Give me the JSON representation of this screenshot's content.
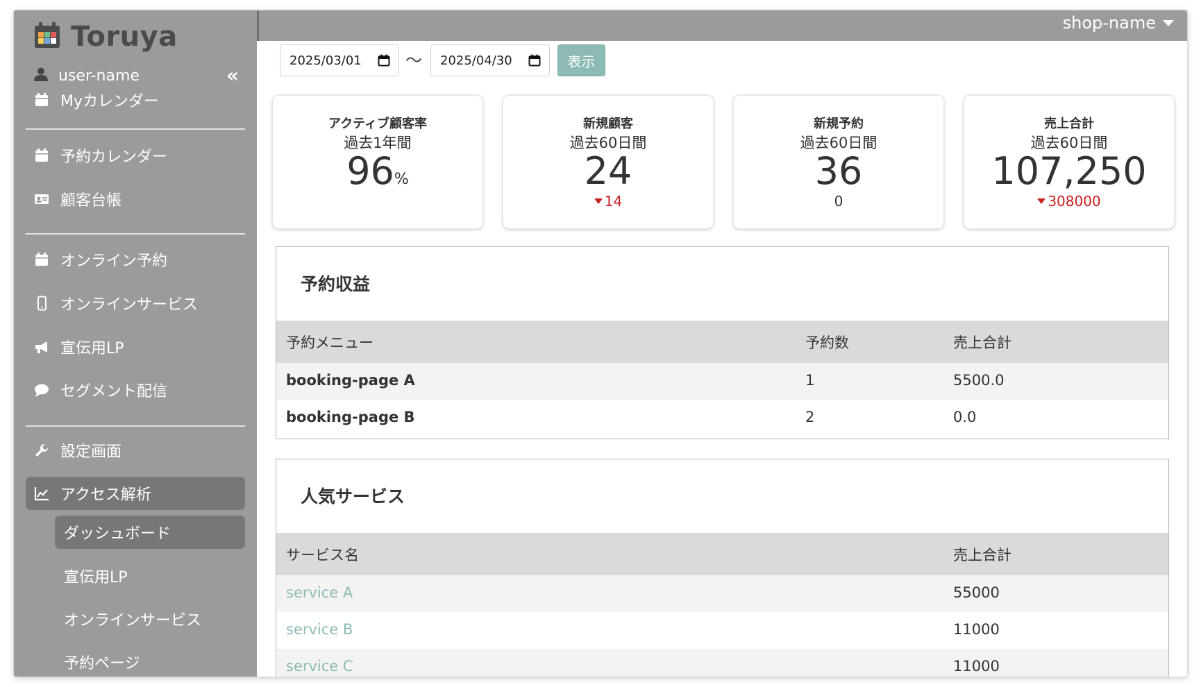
{
  "brand": {
    "name": "Toruya"
  },
  "user": {
    "name": "user-name"
  },
  "collapse_label": "«",
  "nav": {
    "my_calendar": "Myカレンダー",
    "booking_calendar": "予約カレンダー",
    "customers": "顧客台帳",
    "online_booking": "オンライン予約",
    "online_service": "オンラインサービス",
    "promo_lp": "宣伝用LP",
    "segment": "セグメント配信",
    "settings": "設定画面",
    "analytics": "アクセス解析",
    "sub": {
      "dashboard": "ダッシュボード",
      "promo_lp": "宣伝用LP",
      "online_service": "オンラインサービス",
      "booking_page": "予約ページ"
    }
  },
  "header": {
    "shop": "shop-name"
  },
  "filter": {
    "start_date": "2025/03/01",
    "separator": "〜",
    "end_date": "2025/04/30",
    "show_label": "表示"
  },
  "kpis": [
    {
      "title": "アクティブ顧客率",
      "period": "過去1年間",
      "value": "96",
      "unit": "%",
      "delta": "",
      "delta_dir": "none"
    },
    {
      "title": "新規顧客",
      "period": "過去60日間",
      "value": "24",
      "unit": "",
      "delta": "14",
      "delta_dir": "down"
    },
    {
      "title": "新規予約",
      "period": "過去60日間",
      "value": "36",
      "unit": "",
      "delta": "0",
      "delta_dir": "none"
    },
    {
      "title": "売上合計",
      "period": "過去60日間",
      "value": "107,250",
      "unit": "",
      "delta": "308000",
      "delta_dir": "down"
    }
  ],
  "booking_revenue": {
    "title": "予約収益",
    "columns": [
      "予約メニュー",
      "予約数",
      "売上合計"
    ],
    "rows": [
      [
        "booking-page A",
        "1",
        "5500.0"
      ],
      [
        "booking-page B",
        "2",
        "0.0"
      ]
    ]
  },
  "popular_services": {
    "title": "人気サービス",
    "columns": [
      "サービス名",
      "売上合計"
    ],
    "rows": [
      [
        "service A",
        "55000"
      ],
      [
        "service B",
        "11000"
      ],
      [
        "service C",
        "11000"
      ]
    ]
  },
  "colors": {
    "sidebar": "#9b9b9b",
    "active": "#777777",
    "accent": "#8cbab4",
    "down": "#cc1e1e"
  }
}
